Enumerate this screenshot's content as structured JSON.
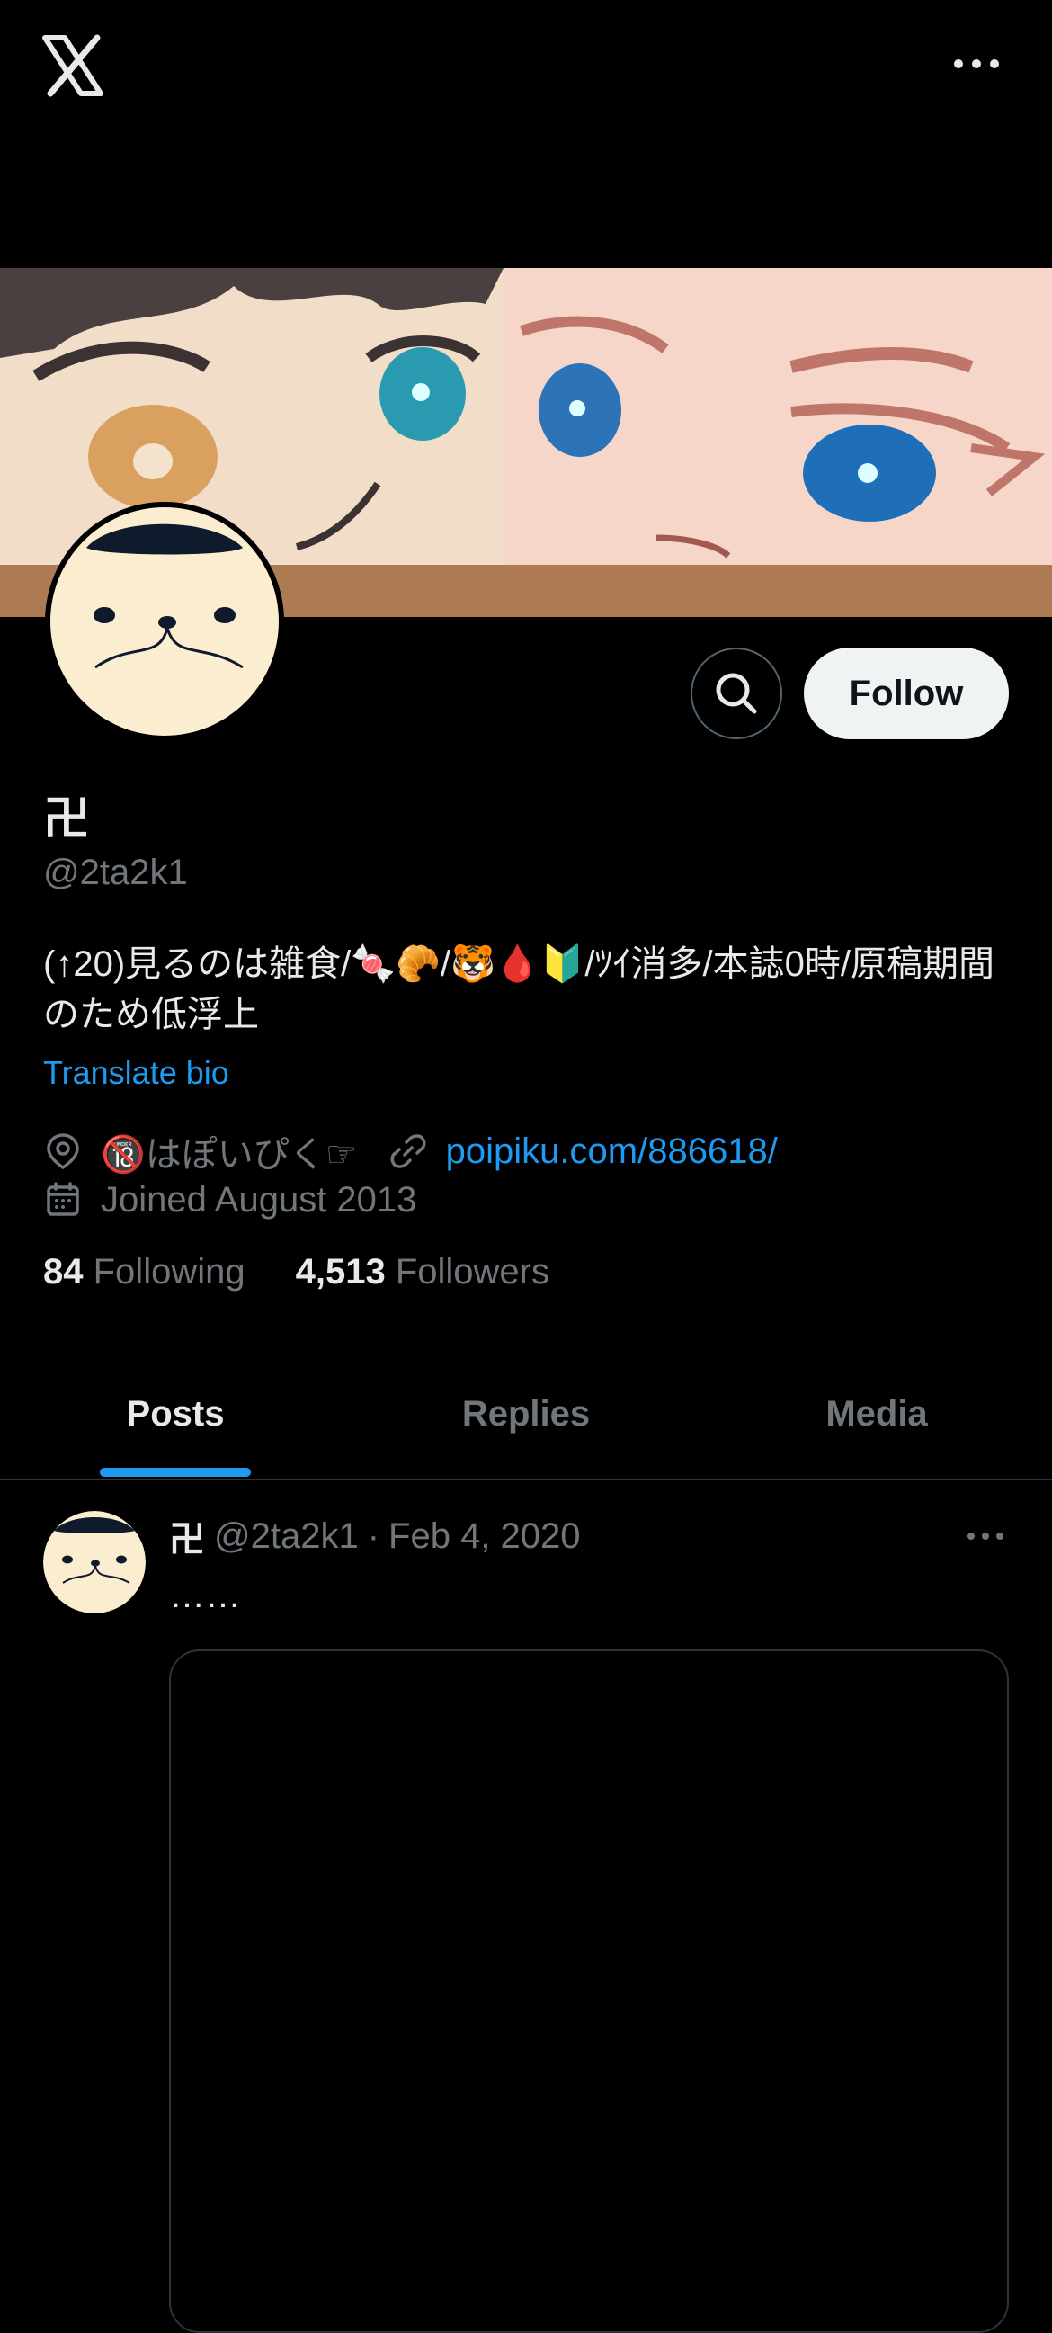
{
  "topbar": {
    "logo": "x-logo-icon",
    "more": "more-icon"
  },
  "profile": {
    "display_name": "卍",
    "handle": "@2ta2k1",
    "bio": "(↑20)見るのは雑食/🍬🥐/🐯🩸🔰/ﾂｲ消多/本誌0時/原稿期間のため低浮上",
    "translate_label": "Translate bio",
    "location": "🔞はぽいぴく☞",
    "website": "poipiku.com/886618/",
    "joined": "Joined August 2013",
    "following_count": "84",
    "following_label": "Following",
    "followers_count": "4,513",
    "followers_label": "Followers"
  },
  "actions": {
    "follow_label": "Follow"
  },
  "tabs": [
    {
      "label": "Posts",
      "active": true
    },
    {
      "label": "Replies",
      "active": false
    },
    {
      "label": "Media",
      "active": false
    }
  ],
  "post": {
    "name": "卍",
    "handle": "@2ta2k1",
    "separator": "·",
    "date": "Feb 4, 2020",
    "text": "……"
  },
  "colors": {
    "accent": "#1d9bf0",
    "background": "#000000",
    "muted": "#71767b"
  }
}
